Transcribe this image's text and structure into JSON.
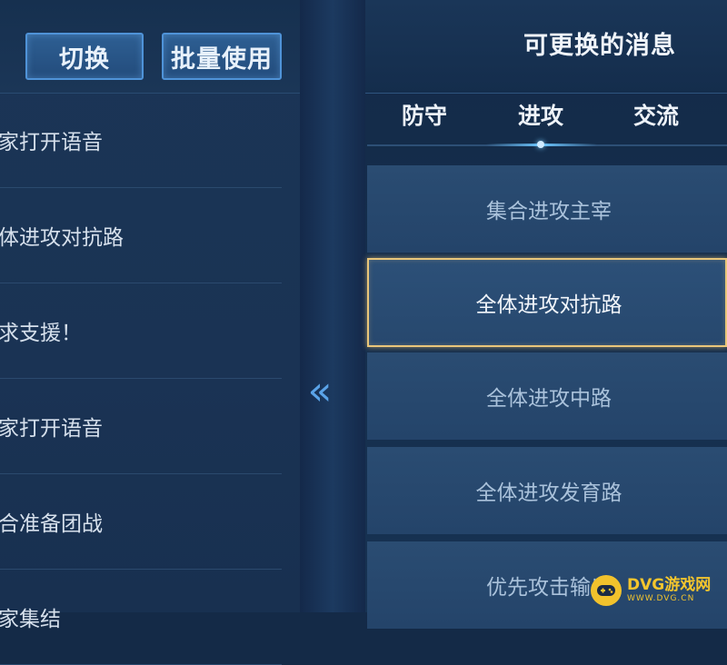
{
  "left": {
    "buttons": {
      "switch": "切换",
      "batch_use": "批量使用"
    },
    "rows": [
      "大家打开语音",
      "全体进攻对抗路",
      "请求支援！",
      "大家打开语音",
      "集合准备团战",
      "大家集结"
    ]
  },
  "arrow_glyph": "«",
  "right": {
    "title": "可更换的消息",
    "tabs": [
      "防守",
      "进攻",
      "交流"
    ],
    "active_tab": "进攻",
    "messages": [
      "集合进攻主宰",
      "全体进攻对抗路",
      "全体进攻中路",
      "全体进攻发育路",
      "优先攻击输出"
    ],
    "selected_message": "全体进攻对抗路"
  },
  "watermark": {
    "main": "DVG游戏网",
    "sub": "WWW.DVG.CN"
  },
  "colors": {
    "accent_blue": "#4f93d8",
    "selected_border": "#e9c67a",
    "watermark": "#f4c52d"
  }
}
